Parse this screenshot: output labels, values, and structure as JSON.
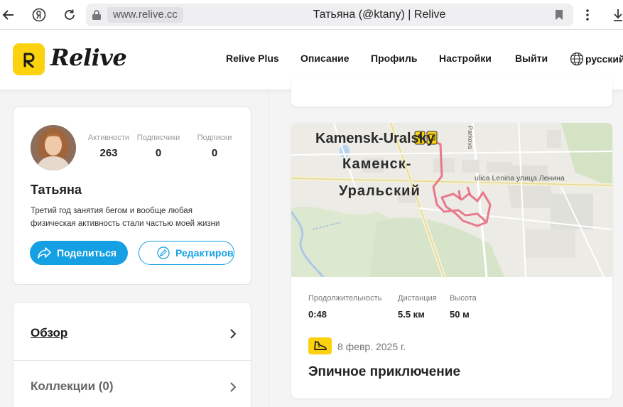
{
  "browser": {
    "url": "www.relive.cc",
    "title": "Татьяна (@ktany) | Relive",
    "back_icon": "arrow-left-icon",
    "yandex_icon": "yandex-icon",
    "reload_icon": "reload-icon",
    "menu_icon": "more-vertical-icon"
  },
  "header": {
    "logo_text": "Relive",
    "brand_color": "#fcd20f",
    "nav": [
      "Relive Plus",
      "Описание",
      "Профиль",
      "Настройки",
      "Выйти"
    ],
    "language": "русский"
  },
  "profile": {
    "name": "Татьяна",
    "bio_line1": "Третий год занятия бегом и вообще любая",
    "bio_line2": "физическая активность стали частью моей жизни",
    "stats": [
      {
        "label": "Активности",
        "value": "263"
      },
      {
        "label": "Подписчики",
        "value": "0"
      },
      {
        "label": "Подписки",
        "value": "0"
      }
    ],
    "share_label": "Поделиться",
    "edit_label": "Редактировать",
    "accent_color": "#14a0e3"
  },
  "menu": {
    "items": [
      {
        "label": "Обзор"
      },
      {
        "label": "Коллекции (0)"
      }
    ]
  },
  "activity": {
    "map_labels": {
      "city_latin": "Kamensk-Uralsky",
      "city_ru_1": "Каменск-",
      "city_ru_2": "Уральский",
      "street": "ulica Lenina улица Ленина",
      "street2": "Parkova"
    },
    "metrics": [
      {
        "label": "Продолжительность",
        "value": "0:48"
      },
      {
        "label": "Дистанция",
        "value": "5.5 км"
      },
      {
        "label": "Высота",
        "value": "50 м"
      }
    ],
    "date": "8 февр. 2025 г.",
    "title": "Эпичное приключение",
    "type_icon": "running-shoe-icon"
  }
}
